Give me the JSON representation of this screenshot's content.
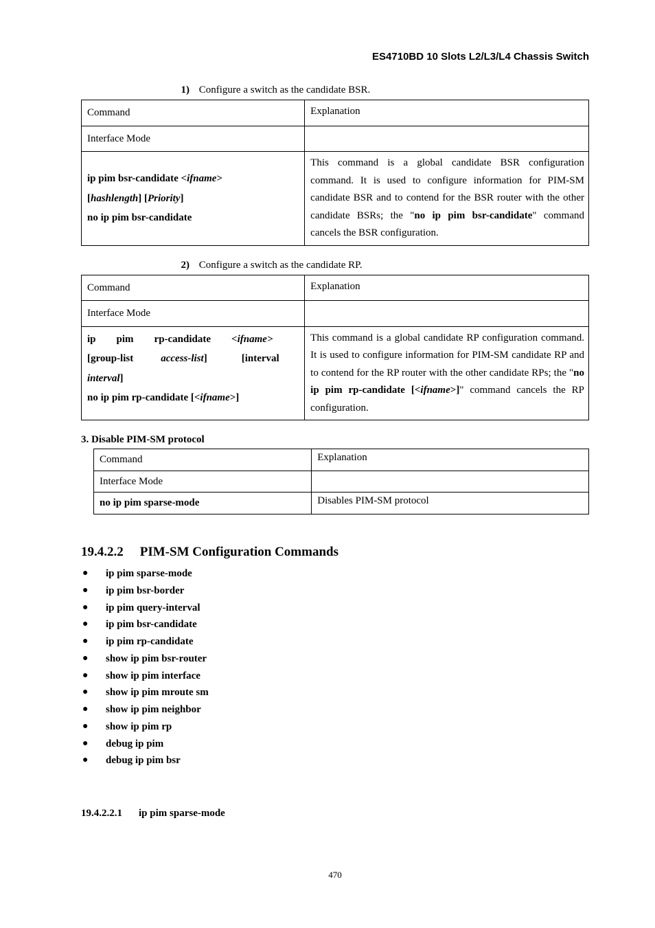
{
  "header": {
    "title": "ES4710BD 10 Slots L2/L3/L4 Chassis Switch"
  },
  "table1": {
    "caption_num": "1)",
    "caption": "Configure a switch as the candidate BSR.",
    "h1": "Command",
    "h2": "Explanation",
    "r2c1": "Interface Mode",
    "cmd_a1": "ip pim bsr-candidate <",
    "cmd_a2": "ifname",
    "cmd_a3": ">",
    "cmd_b1": "[",
    "cmd_b2": "hashlength",
    "cmd_b3": "] [",
    "cmd_b4": "Priority",
    "cmd_b5": "]",
    "cmd_c": "no ip pim bsr-candidate",
    "exp_a": "This command is a global candidate BSR configuration command. It is used to configure information for PIM-SM candidate BSR and to contend for the BSR router with the other candidate BSRs; the \"",
    "exp_b": "no ip pim bsr-candidate",
    "exp_c": "\" command cancels the BSR configuration."
  },
  "table2": {
    "caption_num": "2)",
    "caption": "Configure a switch as the candidate RP.",
    "h1": "Command",
    "h2": "Explanation",
    "r2c1": "Interface Mode",
    "cmd_a1": "ip",
    "cmd_a2": "pim",
    "cmd_a3": "rp-candidate",
    "cmd_a4": "<",
    "cmd_a5": "ifname",
    "cmd_a6": ">",
    "cmd_b1": "[group-list",
    "cmd_b2": "access-list",
    "cmd_b3": "]",
    "cmd_b4": "[interval",
    "cmd_c1": "interval",
    "cmd_c2": "]",
    "cmd_d1": "no ip pim rp-candidate [<",
    "cmd_d2": "ifname",
    "cmd_d3": ">]",
    "exp_a": "This command is a global candidate RP configuration command. It is used to configure information for PIM-SM candidate RP and to contend for the RP router with the other candidate RPs; the \"",
    "exp_b": "no ip pim rp-candidate [<",
    "exp_c": "ifname",
    "exp_d": ">]",
    "exp_e": "\" command cancels the RP configuration."
  },
  "section3": {
    "label": "3. Disable PIM-SM protocol"
  },
  "table3": {
    "h1": "Command",
    "h2": "Explanation",
    "r2c1": "Interface Mode",
    "r3c1": "no ip pim sparse-mode",
    "r3c2": "Disables PIM-SM protocol"
  },
  "h2": {
    "num": "19.4.2.2",
    "title": "PIM-SM Configuration Commands"
  },
  "bullets": [
    "ip pim sparse-mode",
    "ip pim bsr-border",
    "ip pim query-interval",
    "ip pim bsr-candidate",
    "ip pim rp-candidate",
    "show ip pim bsr-router",
    "show ip pim interface",
    "show ip pim mroute sm",
    "show ip pim neighbor",
    "show ip pim rp",
    "debug ip pim",
    "debug ip pim bsr"
  ],
  "h3": {
    "num": "19.4.2.2.1",
    "title": "ip pim sparse-mode"
  },
  "footer": {
    "page": "470"
  }
}
